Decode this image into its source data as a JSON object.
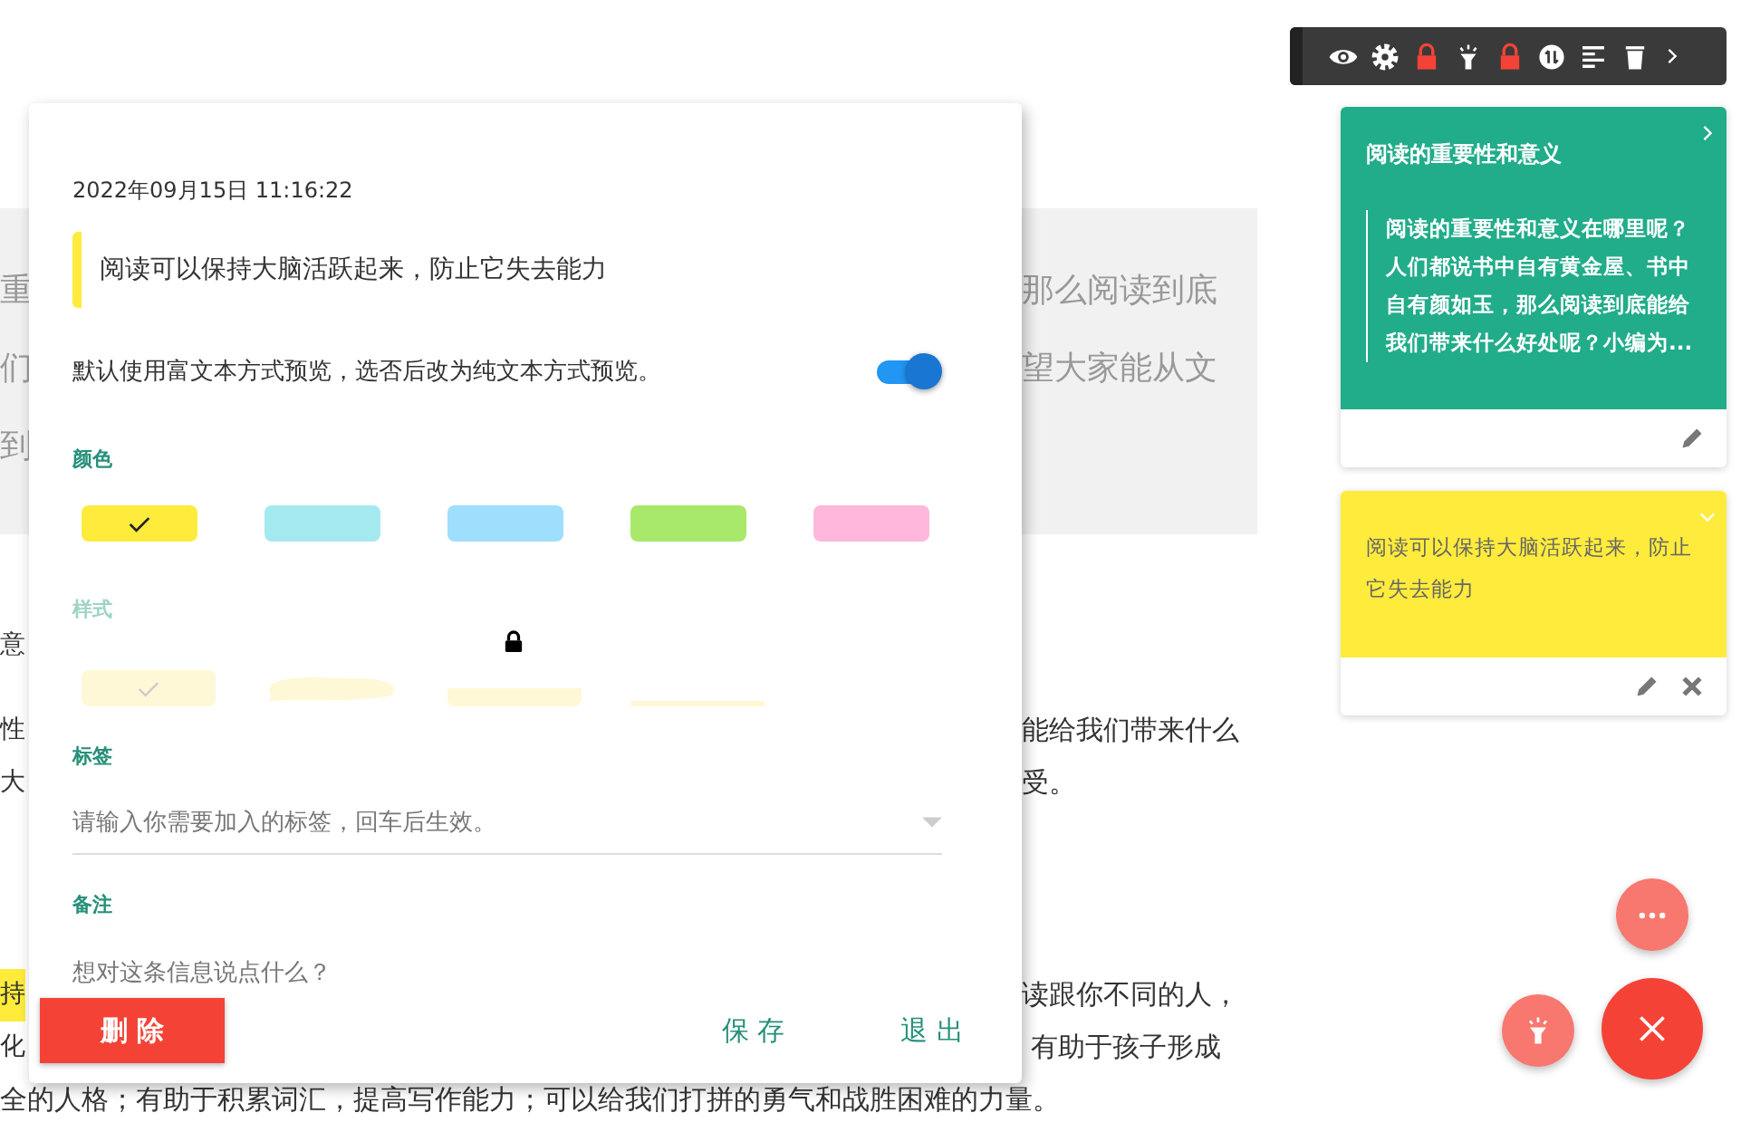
{
  "article": {
    "intro_lines": [
      {
        "left": "重",
        "right": "那么阅读到底"
      },
      {
        "left": "们",
        "right": "望大家能从文"
      },
      {
        "left": "到"
      }
    ],
    "paragraphs": [
      {
        "kind": "text",
        "lines": [
          {
            "left": "意"
          }
        ]
      },
      {
        "kind": "text",
        "lines": [
          {
            "left": "性",
            "right": "能给我们带来什么"
          },
          {
            "left": "大",
            "right": "受。"
          }
        ]
      },
      {
        "kind": "text",
        "lines": [
          {
            "left": "持",
            "highlighted": true,
            "right": "读跟你不同的人，"
          },
          {
            "left": "化",
            "right": " 有助于孩子形成"
          },
          {
            "full": "全的人格；有助于积累词汇，提高写作能力；可以给我们打拼的勇气和战胜困难的力量。"
          }
        ]
      }
    ]
  },
  "dialog": {
    "date": "2022年09月15日 11:16:22",
    "quote": "阅读可以保持大脑活跃起来，防止它失去能力",
    "toggle": {
      "label": "默认使用富文本方式预览，选否后改为纯文本方式预览。",
      "on": true
    },
    "color_label": "颜色",
    "colors": [
      {
        "color": "#ffeb3b",
        "selected": true
      },
      {
        "color": "#a5e9f0",
        "selected": false
      },
      {
        "color": "#a0defd",
        "selected": false
      },
      {
        "color": "#a8e86a",
        "selected": false
      },
      {
        "color": "#ffb8dc",
        "selected": false
      }
    ],
    "style_label": "样式",
    "style_disabled": true,
    "styles": [
      {
        "kind": "fill",
        "selected": true,
        "locked": false
      },
      {
        "kind": "brush",
        "selected": false,
        "locked": false
      },
      {
        "kind": "block-underline",
        "selected": false,
        "locked": true
      },
      {
        "kind": "underline",
        "selected": false,
        "locked": false
      }
    ],
    "tag_label": "标签",
    "tag_placeholder": "请输入你需要加入的标签，回车后生效。",
    "note_label": "备注",
    "note_placeholder": "想对这条信息说点什么？",
    "delete_button": "删 除",
    "save_button": "保 存",
    "exit_button": "退 出"
  },
  "cards": [
    {
      "color": "#21ac8a",
      "title": "阅读的重要性和意义",
      "quote": "阅读的重要性和意义在哪里呢？人们都说书中自有黄金屋、书中自有颜如玉，那么阅读到底能给我们带来什么好处呢？小编为...",
      "expanded": false,
      "deletable": false
    },
    {
      "color": "#ffeb3b",
      "quote": "阅读可以保持大脑活跃起来，防止它失去能力",
      "expanded": true,
      "deletable": true
    }
  ]
}
